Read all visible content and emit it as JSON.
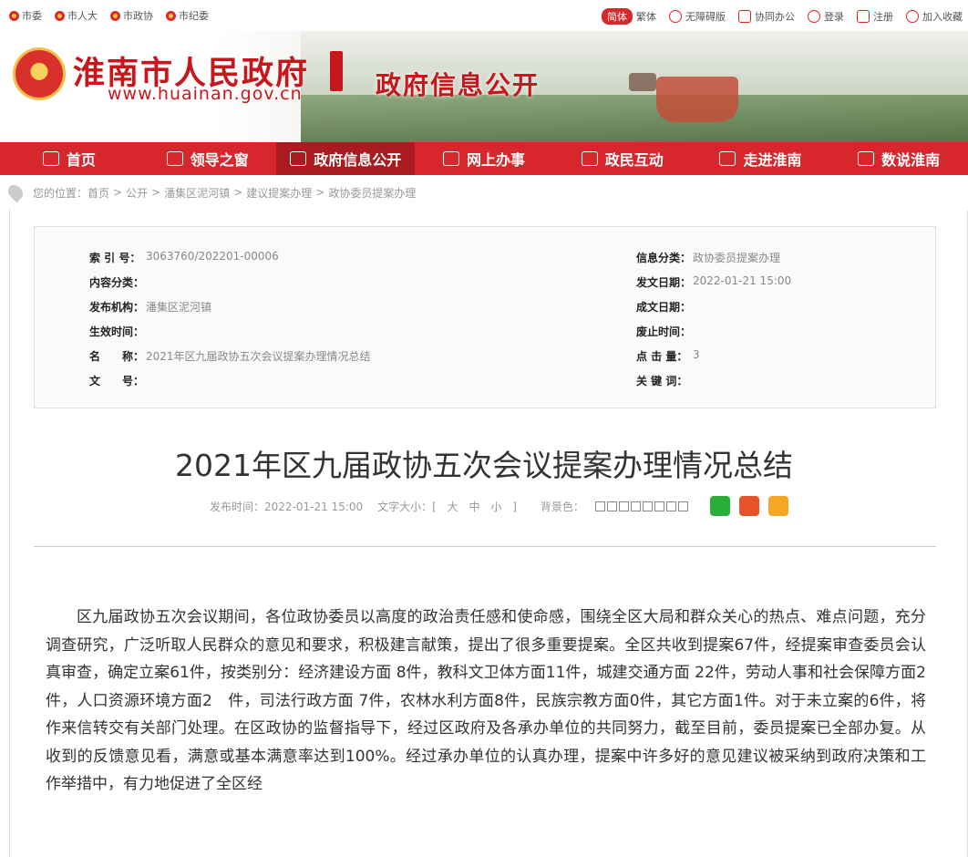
{
  "topbar": {
    "links": [
      "市委",
      "市人大",
      "市政协",
      "市纪委"
    ],
    "lang_simplified": "简体",
    "lang_traditional": "繁体",
    "accessible": "无障碍版",
    "office": "协同办公",
    "login": "登录",
    "register": "注册",
    "favorite": "加入收藏"
  },
  "banner": {
    "site_name": "淮南市人民政府",
    "site_url": "www.huainan.gov.cn",
    "section_title": "政府信息公开"
  },
  "nav": {
    "items": [
      "首页",
      "领导之窗",
      "政府信息公开",
      "网上办事",
      "政民互动",
      "走进淮南",
      "数说淮南"
    ],
    "active_index": 2
  },
  "breadcrumb": {
    "prefix": "您的位置：",
    "items": [
      "首页",
      "公开",
      "潘集区泥河镇",
      "建议提案办理",
      "政协委员提案办理"
    ]
  },
  "meta": {
    "left": [
      {
        "k": "索 引 号：",
        "v": "3063760/202201-00006"
      },
      {
        "k": "内容分类：",
        "v": ""
      },
      {
        "k": "发布机构：",
        "v": "潘集区泥河镇"
      },
      {
        "k": "生效时间：",
        "v": ""
      },
      {
        "k": "名　　称：",
        "v": "2021年区九届政协五次会议提案办理情况总结"
      },
      {
        "k": "文　　号：",
        "v": ""
      }
    ],
    "right": [
      {
        "k": "信息分类：",
        "v": "政协委员提案办理"
      },
      {
        "k": "发文日期：",
        "v": "2022-01-21 15:00"
      },
      {
        "k": "成文日期：",
        "v": ""
      },
      {
        "k": "废止时间：",
        "v": ""
      },
      {
        "k": "点 击 量：",
        "v": "3"
      },
      {
        "k": "关 键 词：",
        "v": ""
      }
    ]
  },
  "article": {
    "title": "2021年区九届政协五次会议提案办理情况总结",
    "publish_label": "发布时间：2022-01-21 15:00",
    "font_size_label": "文字大小：[",
    "font_sizes": [
      "大",
      "中",
      "小"
    ],
    "font_size_close": "]",
    "bg_label": "背景色：",
    "body": "区九届政协五次会议期间，各位政协委员以高度的政治责任感和使命感，围绕全区大局和群众关心的热点、难点问题，充分调查研究，广泛听取人民群众的意见和要求，积极建言献策，提出了很多重要提案。全区共收到提案67件，经提案审查委员会认真审查，确定立案61件，按类别分：经济建设方面 8件，教科文卫体方面11件，城建交通方面 22件，劳动人事和社会保障方面2　件，人口资源环境方面2　件，司法行政方面 7件，农林水利方面8件，民族宗教方面0件，其它方面1件。对于未立案的6件，将作来信转交有关部门处理。在区政协的监督指导下，经过区政府及各承办单位的共同努力，截至目前，委员提案已全部办复。从收到的反馈意见看，满意或基本满意率达到100%。经过承办单位的认真办理，提案中许多好的意见建议被采纳到政府决策和工作举措中，有力地促进了全区经"
  },
  "colors": {
    "brand_red": "#d7262c",
    "nav_active": "#a91b1f",
    "share_wechat": "#2aae3a",
    "share_weibo": "#e9532a",
    "share_fav": "#f5a623"
  }
}
